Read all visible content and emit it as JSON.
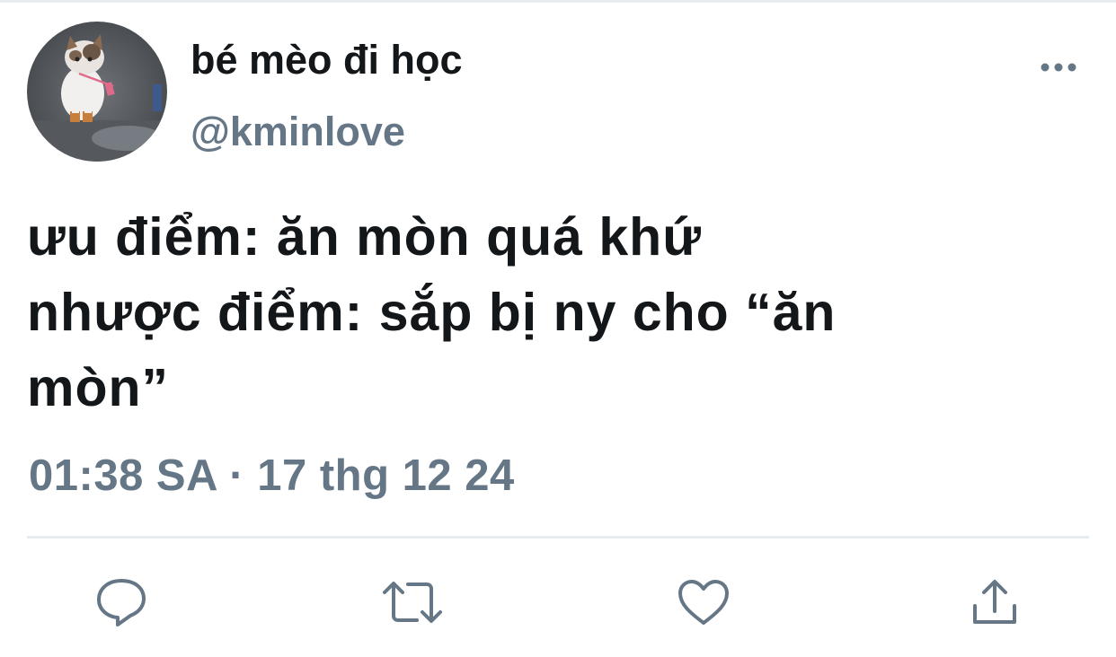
{
  "user": {
    "display_name": "bé mèo đi học",
    "handle": "@kminlove"
  },
  "tweet": {
    "lines": [
      "ưu điểm: ăn mòn quá khứ",
      "nhược điểm: sắp bị ny cho “ăn",
      "mòn”"
    ],
    "timestamp": "01:38 SA · 17 thg 12 24"
  },
  "actions": [
    {
      "icon": "reply-icon"
    },
    {
      "icon": "retweet-icon"
    },
    {
      "icon": "like-icon"
    },
    {
      "icon": "share-icon"
    }
  ],
  "colors": {
    "text_primary": "#14171a",
    "text_secondary": "#657786",
    "icon": "#657786",
    "divider": "#e6ecf0"
  }
}
